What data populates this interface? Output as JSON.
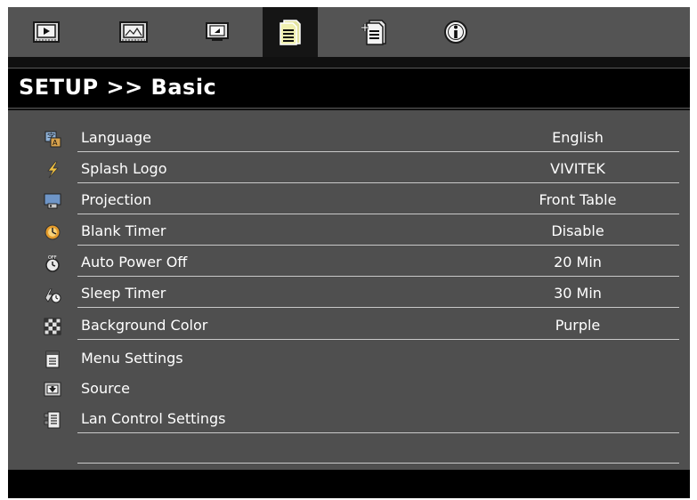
{
  "tabs": [
    {
      "id": "picture",
      "icon": "play-icon"
    },
    {
      "id": "image",
      "icon": "image-icon"
    },
    {
      "id": "display",
      "icon": "monitor-icon"
    },
    {
      "id": "setup-basic",
      "icon": "document-icon",
      "active": true
    },
    {
      "id": "setup-advanced",
      "icon": "document-add-icon"
    },
    {
      "id": "info",
      "icon": "info-icon"
    }
  ],
  "title": "SETUP >> Basic",
  "items": [
    {
      "label": "Language",
      "value": "English",
      "icon": "language-icon"
    },
    {
      "label": "Splash Logo",
      "value": "VIVITEK",
      "icon": "lightning-icon"
    },
    {
      "label": "Projection",
      "value": "Front Table",
      "icon": "projection-icon"
    },
    {
      "label": "Blank Timer",
      "value": "Disable",
      "icon": "blank-timer-icon"
    },
    {
      "label": "Auto Power Off",
      "value": "20 Min",
      "icon": "auto-power-off-icon"
    },
    {
      "label": "Sleep Timer",
      "value": "30 Min",
      "icon": "sleep-timer-icon"
    },
    {
      "label": "Background Color",
      "value": "Purple",
      "icon": "checkerboard-icon"
    },
    {
      "label": "Menu Settings",
      "value": "",
      "icon": "menu-settings-icon"
    },
    {
      "label": "Source",
      "value": "",
      "icon": "source-icon"
    },
    {
      "label": "Lan Control Settings",
      "value": "",
      "icon": "lan-control-icon"
    }
  ],
  "colors": {
    "tab_bar": "#545454",
    "active_tab": "#151515",
    "panel": "#4f4f4f",
    "title_bar": "#000000",
    "text": "#ffffff"
  }
}
